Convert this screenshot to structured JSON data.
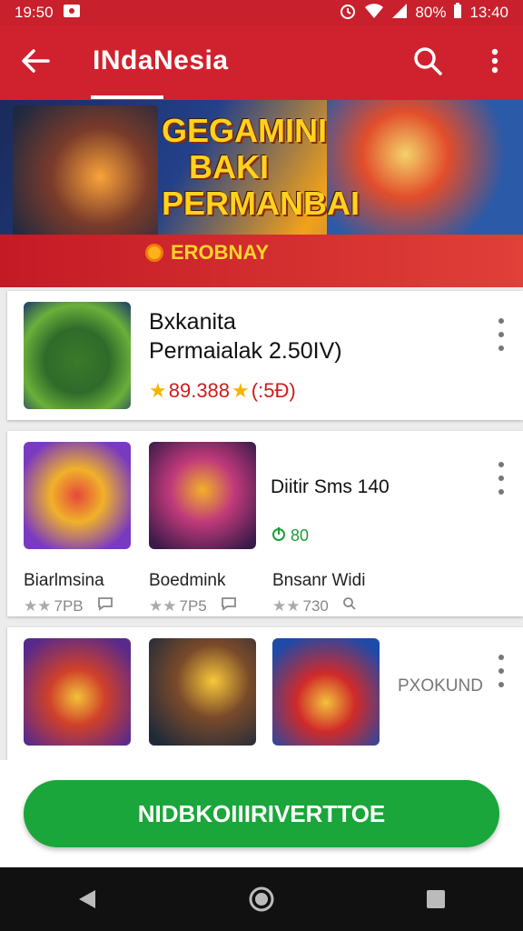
{
  "status_bar": {
    "time": "19:50",
    "battery": "80%",
    "clock_right": "13:40"
  },
  "app_bar": {
    "title": "INdaNesia"
  },
  "banner": {
    "headline_line1": "GEGAMINI",
    "headline_line2": "BAKI",
    "headline_line3": "PERMANBAI",
    "strip_label": "EROBNAY"
  },
  "featured": {
    "title_line1": "Bxkanita",
    "title_line2": "Permaialak  2.50IV)",
    "rating_text": "89.388",
    "rating_suffix": "(:5Ð)"
  },
  "grid_row1": {
    "items": [
      {
        "name": "Biarlmsina",
        "rating": "7PB"
      },
      {
        "name": "Boedmink",
        "rating": "7P5"
      },
      {
        "name": "Bnsanr Widi",
        "rating": "730"
      }
    ],
    "side_title": "Diitir Sms 140",
    "side_badge": "80"
  },
  "grid_row2": {
    "side_label": "PXOKUND"
  },
  "cta": {
    "label": "NIDBKOIIIRIVERTTOE"
  },
  "colors": {
    "primary_red": "#d0222e",
    "cta_green": "#1aa63a",
    "star_gold": "#f4b400"
  }
}
